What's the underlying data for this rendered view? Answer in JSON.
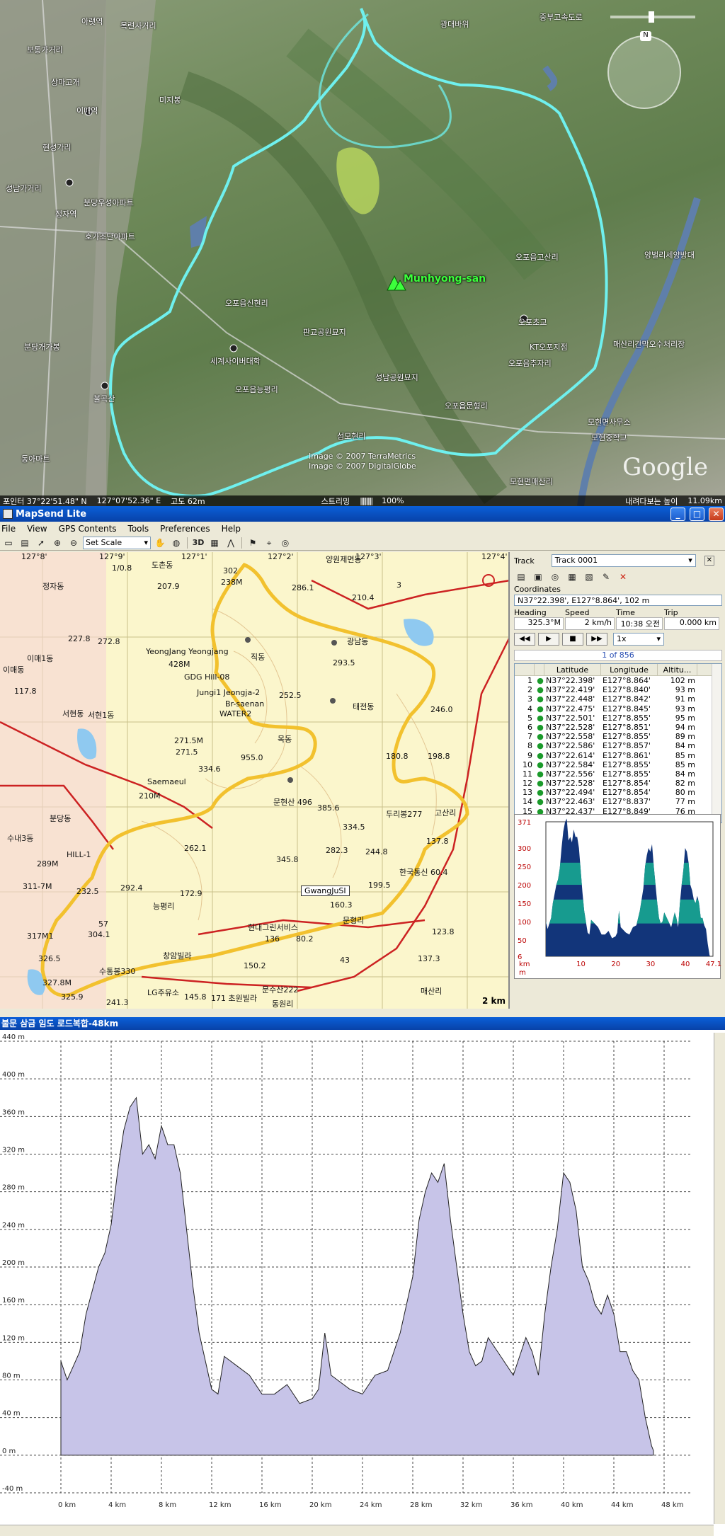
{
  "satellite": {
    "peak_name": "Munhyong-san",
    "places": [
      "아랫역",
      "목련사거리",
      "보통가거리",
      "상마고개",
      "이매역",
      "현성가리",
      "성남가거리",
      "분당우성아파트",
      "정자역",
      "호가조단아파트",
      "미지봉",
      "오포읍신현리",
      "판교공원묘지",
      "세계사이버대학",
      "오포읍능평리",
      "성남공원묘지",
      "오포읍문형리",
      "섬모현리",
      "분당개가봉",
      "동아마트",
      "불곡산",
      "오포읍고산리",
      "오포초교",
      "오포읍추자리",
      "KT오포지점",
      "매산리간막오수처리장",
      "양벌리세양방대",
      "모현면사무소",
      "모현중학교",
      "모현면매산리",
      "광대바위",
      "중부고속도로"
    ],
    "copyright": [
      "Image © 2007 TerraMetrics",
      "Image © 2007 DigitalGlobe"
    ],
    "logo": "Google",
    "status": {
      "pointer": "포인터  37°22'51.48\" N",
      "lon": "127°07'52.36\" E",
      "elev": "고도  62m",
      "streaming_label": "스트리밍",
      "streaming_pct": "100%",
      "eye_label": "내려다보는 높이",
      "eye_alt": "11.09km"
    },
    "nav_north": "N"
  },
  "mapsend": {
    "title": "MapSend Lite",
    "menu": [
      "File",
      "View",
      "GPS Contents",
      "Tools",
      "Preferences",
      "Help"
    ],
    "scale_select": "Set Scale",
    "btn_3d": "3D",
    "map_labels": [
      {
        "t": "127°8'"
      },
      {
        "t": "127°9'"
      },
      {
        "t": "127°1'"
      },
      {
        "t": "127°2'"
      },
      {
        "t": "127°3'"
      },
      {
        "t": "127°4'"
      },
      {
        "t": "도촌동"
      },
      {
        "t": "302"
      },
      {
        "t": "238M"
      },
      {
        "t": "286.1"
      },
      {
        "t": "양원제면동"
      },
      {
        "t": "210.4"
      },
      {
        "t": "3"
      },
      {
        "t": "광남동"
      },
      {
        "t": "293.5"
      },
      {
        "t": "YeongJang Yeongjang"
      },
      {
        "t": "428M"
      },
      {
        "t": "GDG Hill-08"
      },
      {
        "t": "직동"
      },
      {
        "t": "Jungi1 Jeongja-2"
      },
      {
        "t": "Br-saenan"
      },
      {
        "t": "WATER2"
      },
      {
        "t": "252.5"
      },
      {
        "t": "태전동"
      },
      {
        "t": "246.0"
      },
      {
        "t": "271.5M"
      },
      {
        "t": "271.5"
      },
      {
        "t": "955.0"
      },
      {
        "t": "334.6"
      },
      {
        "t": "목동"
      },
      {
        "t": "180.8"
      },
      {
        "t": "198.8"
      },
      {
        "t": "Saemaeul"
      },
      {
        "t": "210M"
      },
      {
        "t": "문현산 496"
      },
      {
        "t": "385.6"
      },
      {
        "t": "334.5"
      },
      {
        "t": "두리봉277"
      },
      {
        "t": "고산리"
      },
      {
        "t": "GwangJuSI"
      },
      {
        "t": "262.1"
      },
      {
        "t": "345.8"
      },
      {
        "t": "282.3"
      },
      {
        "t": "244.8"
      },
      {
        "t": "137.8"
      },
      {
        "t": "HILL-1"
      },
      {
        "t": "289M"
      },
      {
        "t": "232.5"
      },
      {
        "t": "292.4"
      },
      {
        "t": "172.9"
      },
      {
        "t": "199.5"
      },
      {
        "t": "한국통신 60.4"
      },
      {
        "t": "311-7M"
      },
      {
        "t": "능평리"
      },
      {
        "t": "160.3"
      },
      {
        "t": "문형리"
      },
      {
        "t": "304.1"
      },
      {
        "t": "57"
      },
      {
        "t": "현대그린서비스"
      },
      {
        "t": "123.8"
      },
      {
        "t": "317M1"
      },
      {
        "t": "창암빌라"
      },
      {
        "t": "136"
      },
      {
        "t": "80.2"
      },
      {
        "t": "137.3"
      },
      {
        "t": "43"
      },
      {
        "t": "326.5"
      },
      {
        "t": "수통봉330"
      },
      {
        "t": "150.2"
      },
      {
        "t": "327.8M"
      },
      {
        "t": "325.9"
      },
      {
        "t": "241.3"
      },
      {
        "t": "LG주유소"
      },
      {
        "t": "145.8"
      },
      {
        "t": "171 초원빌라"
      },
      {
        "t": "문수산222"
      },
      {
        "t": "동원리"
      },
      {
        "t": "매산리"
      },
      {
        "t": "1/0.8"
      },
      {
        "t": "207.9"
      },
      {
        "t": "272.8"
      },
      {
        "t": "227.8"
      },
      {
        "t": "117.8"
      },
      {
        "t": "이매1동"
      },
      {
        "t": "서현동"
      },
      {
        "t": "서현1동"
      },
      {
        "t": "이매동"
      },
      {
        "t": "정자동"
      },
      {
        "t": "수내3동"
      },
      {
        "t": "분당동"
      }
    ],
    "map_scale": "2 km",
    "track_label": "Track",
    "track_value": "Track 0001",
    "coords_label": "Coordinates",
    "coords_value": "N37°22.398', E127°8.864', 102 m",
    "heading_label": "Heading",
    "speed_label": "Speed",
    "time_label": "Time",
    "trip_label": "Trip",
    "heading_value": "325.3°M",
    "speed_value": "2 km/h",
    "time_value": "10:38 오전",
    "trip_value": "0.000 km",
    "speed_mult": "1x",
    "counter": "1 of 856",
    "table_headers": [
      "",
      "",
      "Latitude",
      "Longitude",
      "Altitu..."
    ],
    "table_rows": [
      [
        "1",
        "N37°22.398'",
        "E127°8.864'",
        "102 m"
      ],
      [
        "2",
        "N37°22.419'",
        "E127°8.840'",
        "93 m"
      ],
      [
        "3",
        "N37°22.448'",
        "E127°8.842'",
        "91 m"
      ],
      [
        "4",
        "N37°22.475'",
        "E127°8.845'",
        "93 m"
      ],
      [
        "5",
        "N37°22.501'",
        "E127°8.855'",
        "95 m"
      ],
      [
        "6",
        "N37°22.528'",
        "E127°8.851'",
        "94 m"
      ],
      [
        "7",
        "N37°22.558'",
        "E127°8.855'",
        "89 m"
      ],
      [
        "8",
        "N37°22.586'",
        "E127°8.857'",
        "84 m"
      ],
      [
        "9",
        "N37°22.614'",
        "E127°8.861'",
        "85 m"
      ],
      [
        "10",
        "N37°22.584'",
        "E127°8.855'",
        "85 m"
      ],
      [
        "11",
        "N37°22.556'",
        "E127°8.855'",
        "84 m"
      ],
      [
        "12",
        "N37°22.528'",
        "E127°8.854'",
        "82 m"
      ],
      [
        "13",
        "N37°22.494'",
        "E127°8.854'",
        "80 m"
      ],
      [
        "14",
        "N37°22.463'",
        "E127°8.837'",
        "77 m"
      ],
      [
        "15",
        "N37°22.437'",
        "E127°8.849'",
        "76 m"
      ]
    ],
    "mini_yticks": [
      "371",
      "300",
      "250",
      "200",
      "150",
      "100",
      "50",
      "6"
    ],
    "mini_xticks": [
      "10",
      "20",
      "30",
      "40",
      "47.15"
    ],
    "mini_unit_x": "km",
    "mini_unit_y": "m",
    "colors": {
      "track": "#f2c12e",
      "road": "#cc2222",
      "mini_dark": "#12357a",
      "mini_teal": "#179b8f"
    }
  },
  "profile": {
    "title": "불문 삼금 임도 로드복합-48km",
    "yticks": [
      "440 m",
      "400 m",
      "360 m",
      "320 m",
      "280 m",
      "240 m",
      "200 m",
      "160 m",
      "120 m",
      "80 m",
      "40 m",
      "0 m",
      "-40 m"
    ],
    "xticks": [
      "0 km",
      "4 km",
      "8 km",
      "12 km",
      "16 km",
      "20 km",
      "24 km",
      "28 km",
      "32 km",
      "36 km",
      "40 km",
      "44 km",
      "48 km"
    ],
    "fill_color": "#c7c4e8"
  },
  "chart_data": {
    "type": "area",
    "title": "불문 삼금 임도 로드복합-48km",
    "xlabel": "",
    "ylabel": "",
    "xlim": [
      0,
      48
    ],
    "ylim": [
      -40,
      440
    ],
    "grid": true,
    "x": [
      0,
      0.5,
      1,
      1.5,
      2,
      2.5,
      3,
      3.5,
      4,
      4.5,
      5,
      5.5,
      6,
      6.5,
      7,
      7.5,
      8,
      8.5,
      9,
      9.5,
      10,
      10.5,
      11,
      11.5,
      12,
      12.5,
      13,
      14,
      15,
      16,
      17,
      18,
      19,
      20,
      20.5,
      21,
      21.5,
      22,
      23,
      24,
      25,
      26,
      27,
      28,
      28.5,
      29,
      29.5,
      30,
      30.5,
      31,
      31.5,
      32,
      32.5,
      33,
      33.5,
      34,
      35,
      36,
      36.5,
      37,
      37.5,
      38,
      38.5,
      39,
      39.5,
      40,
      40.5,
      41,
      41.5,
      42,
      42.5,
      43,
      43.5,
      44,
      44.5,
      45,
      45.5,
      46,
      46.5,
      47,
      47.15
    ],
    "values": [
      100,
      80,
      95,
      110,
      150,
      175,
      200,
      215,
      245,
      300,
      345,
      370,
      380,
      320,
      330,
      315,
      350,
      330,
      330,
      300,
      240,
      180,
      130,
      100,
      70,
      65,
      105,
      95,
      85,
      65,
      65,
      75,
      55,
      60,
      70,
      130,
      85,
      80,
      70,
      65,
      85,
      90,
      130,
      190,
      250,
      280,
      300,
      290,
      310,
      250,
      200,
      150,
      110,
      95,
      100,
      125,
      105,
      85,
      105,
      125,
      110,
      85,
      150,
      200,
      240,
      300,
      290,
      260,
      200,
      185,
      160,
      150,
      170,
      150,
      110,
      110,
      90,
      80,
      40,
      10,
      5,
      0,
      0
    ]
  }
}
